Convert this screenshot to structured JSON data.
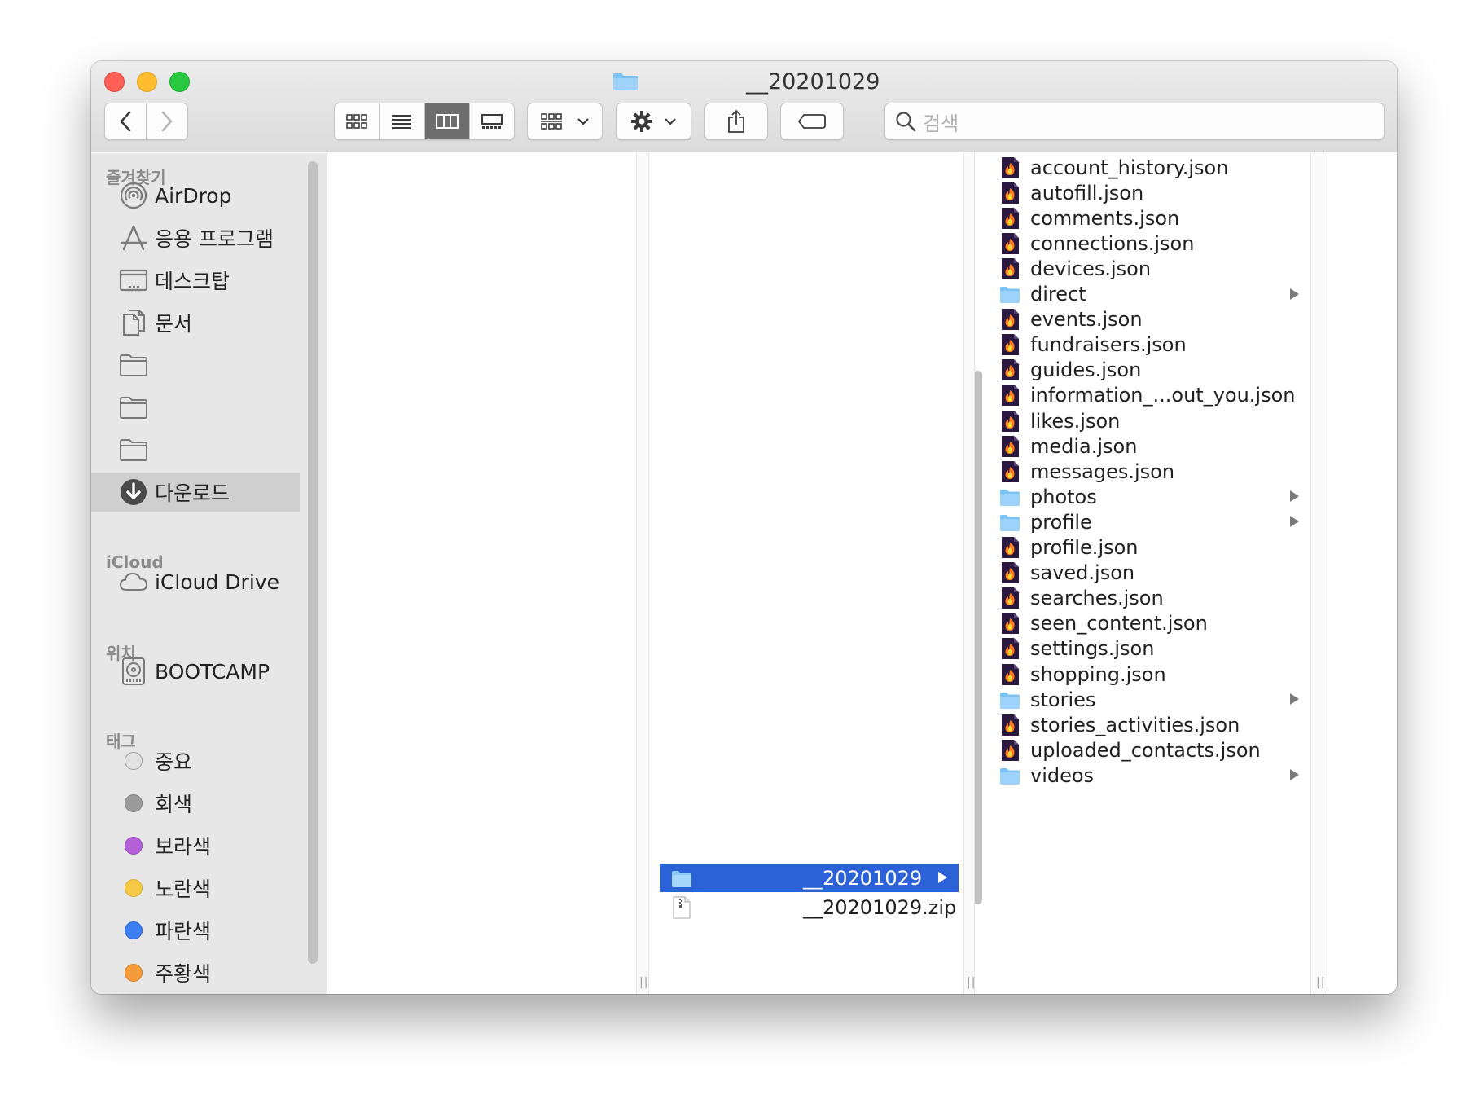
{
  "window": {
    "title": "__20201029",
    "search_placeholder": "검색"
  },
  "sidebar": {
    "favorites_header": "즐겨찾기",
    "favorites": [
      {
        "label": "AirDrop",
        "icon": "airdrop-icon"
      },
      {
        "label": "응용 프로그램",
        "icon": "applications-icon"
      },
      {
        "label": "데스크탑",
        "icon": "desktop-icon"
      },
      {
        "label": "문서",
        "icon": "documents-icon"
      },
      {
        "label": "",
        "icon": "folder-icon"
      },
      {
        "label": "",
        "icon": "folder-icon"
      },
      {
        "label": "",
        "icon": "folder-icon"
      },
      {
        "label": "다운로드",
        "icon": "downloads-icon",
        "selected": true
      }
    ],
    "icloud_header": "iCloud",
    "icloud_items": [
      {
        "label": "iCloud Drive",
        "icon": "cloud-icon"
      }
    ],
    "locations_header": "위치",
    "locations": [
      {
        "label": "BOOTCAMP",
        "icon": "disk-icon"
      }
    ],
    "tags_header": "태그",
    "tags": [
      {
        "label": "중요",
        "color": "#e3e3e3"
      },
      {
        "label": "회색",
        "color": "#9a9a9a"
      },
      {
        "label": "보라색",
        "color": "#b45fd8"
      },
      {
        "label": "노란색",
        "color": "#f5c846"
      },
      {
        "label": "파란색",
        "color": "#3d7ef0"
      },
      {
        "label": "주황색",
        "color": "#f39a3a"
      }
    ]
  },
  "column2": [
    {
      "label": "__20201029",
      "type": "folder",
      "selected": true
    },
    {
      "label": "__20201029.zip",
      "type": "zip"
    }
  ],
  "column3": [
    {
      "label": "account_history.json",
      "type": "json"
    },
    {
      "label": "autofill.json",
      "type": "json"
    },
    {
      "label": "comments.json",
      "type": "json"
    },
    {
      "label": "connections.json",
      "type": "json"
    },
    {
      "label": "devices.json",
      "type": "json"
    },
    {
      "label": "direct",
      "type": "folder"
    },
    {
      "label": "events.json",
      "type": "json"
    },
    {
      "label": "fundraisers.json",
      "type": "json"
    },
    {
      "label": "guides.json",
      "type": "json"
    },
    {
      "label": "information_...out_you.json",
      "type": "json"
    },
    {
      "label": "likes.json",
      "type": "json"
    },
    {
      "label": "media.json",
      "type": "json"
    },
    {
      "label": "messages.json",
      "type": "json"
    },
    {
      "label": "photos",
      "type": "folder"
    },
    {
      "label": "profile",
      "type": "folder"
    },
    {
      "label": "profile.json",
      "type": "json"
    },
    {
      "label": "saved.json",
      "type": "json"
    },
    {
      "label": "searches.json",
      "type": "json"
    },
    {
      "label": "seen_content.json",
      "type": "json"
    },
    {
      "label": "settings.json",
      "type": "json"
    },
    {
      "label": "shopping.json",
      "type": "json"
    },
    {
      "label": "stories",
      "type": "folder"
    },
    {
      "label": "stories_activities.json",
      "type": "json"
    },
    {
      "label": "uploaded_contacts.json",
      "type": "json"
    },
    {
      "label": "videos",
      "type": "folder"
    }
  ],
  "colors": {
    "selection": "#2b62d8",
    "folder": "#7cc3f5",
    "json_bg": "#2a1840"
  }
}
